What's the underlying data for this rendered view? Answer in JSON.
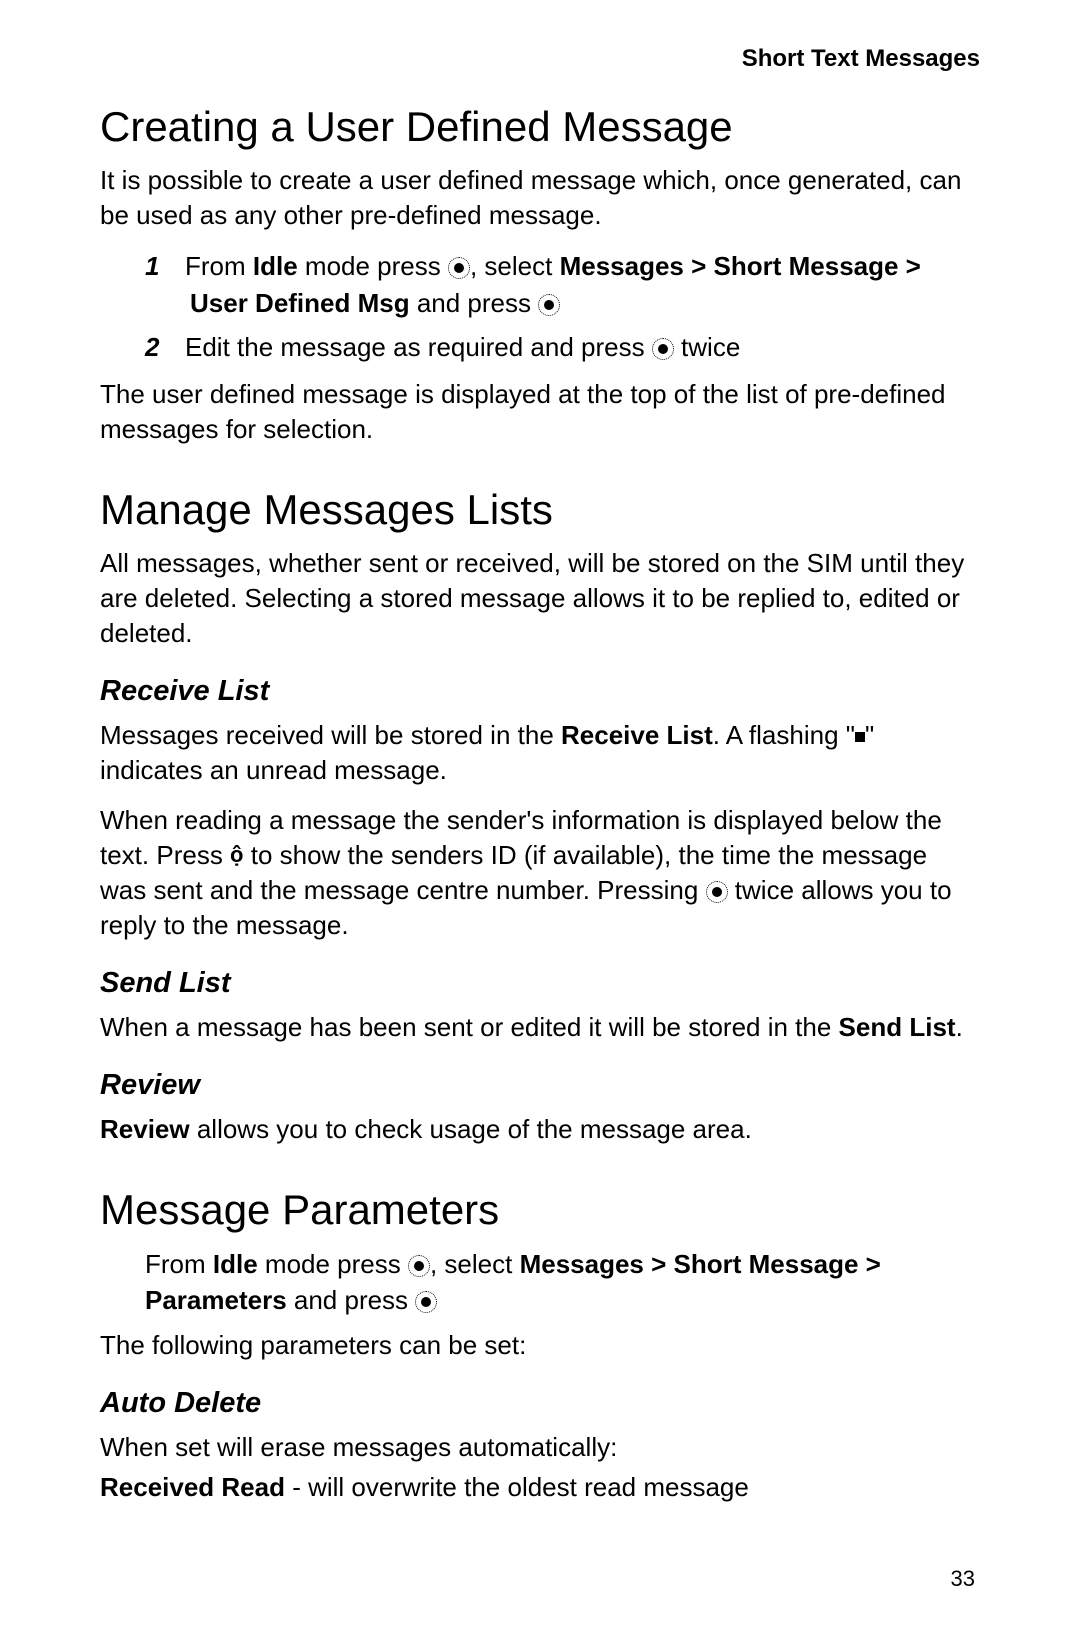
{
  "header": "Short Text Messages",
  "s1": {
    "title": "Creating a User Defined Message",
    "intro": "It is possible to create a user defined message which, once generated, can be used as any other pre-defined message.",
    "step1_pre": "From ",
    "step1_b1": "Idle",
    "step1_mid1": " mode press ",
    "step1_mid2": ", select ",
    "step1_b2": "Messages > Short Message > User Defined Msg",
    "step1_mid3": " and press ",
    "step2_pre": "Edit the message as required and press ",
    "step2_post": " twice",
    "after": "The user defined message is displayed at the top of the list of pre-defined messages for selection."
  },
  "s2": {
    "title": "Manage Messages Lists",
    "intro": "All messages, whether sent or received, will be stored on the SIM until they are deleted. Selecting a stored message allows it to be replied to, edited or deleted.",
    "rl_title": "Receive List",
    "rl_p1a": "Messages received will be stored in the ",
    "rl_p1b": "Receive List",
    "rl_p1c": ". A flashing \"",
    "rl_p1d": "\" indicates an unread message.",
    "rl_p2a": "When reading a message the sender's information is displayed below the text. Press ",
    "rl_p2b": " to show the senders ID (if available), the time the message was sent and the message centre number. Pressing ",
    "rl_p2c": " twice allows you to reply to the message.",
    "sl_title": "Send List",
    "sl_p1a": "When a message has been sent or edited it will be stored in the ",
    "sl_p1b": "Send List",
    "sl_p1c": ".",
    "rv_title": "Review",
    "rv_b": "Review",
    "rv_p": " allows you to check usage of the message area."
  },
  "s3": {
    "title": "Message Parameters",
    "step_pre": "From ",
    "step_b1": "Idle",
    "step_mid1": " mode press ",
    "step_mid2": ", select ",
    "step_b2": "Messages > Short Message > Parameters",
    "step_mid3": " and press ",
    "after": "The following parameters can be set:",
    "ad_title": "Auto Delete",
    "ad_p1": "When set will erase messages automatically:",
    "ad_b": "Received Read",
    "ad_p2": " - will overwrite the oldest read message"
  },
  "pagenum": "33"
}
